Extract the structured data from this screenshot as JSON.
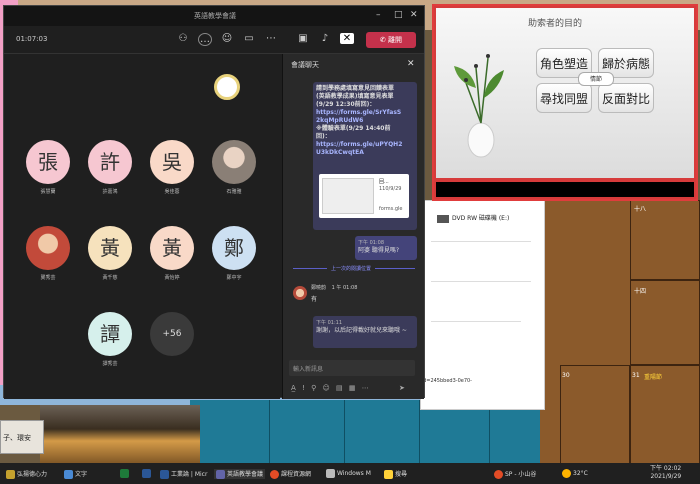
{
  "desktop": {
    "sticky_note": "子、環安",
    "calendar_right": {
      "cell_30": "30",
      "cell_31": "31",
      "cell_label_31": "重陽節",
      "row_labels": [
        "十八",
        "十四"
      ]
    },
    "dvd_label": "DVD RW 磁碟機 (E:)",
    "url_fragment": "ed=245bbed3-0e70-"
  },
  "teams": {
    "window_title": "英語教學會議",
    "elapsed_time": "01:07:03",
    "leave_label": "離開",
    "participants": [
      {
        "initial": "張",
        "name": "張慧蘭",
        "color": "#f6c7d1"
      },
      {
        "initial": "許",
        "name": "許嘉鴻",
        "color": "#f6c7d1"
      },
      {
        "initial": "吳",
        "name": "吳佳蓉",
        "color": "#f9d9c8"
      },
      {
        "initial": "",
        "name": "石雅雅",
        "color": "#9a8f86"
      },
      {
        "initial": "",
        "name": "龔秀芸",
        "color": "#c24a3a"
      },
      {
        "initial": "黃",
        "name": "黃千慈",
        "color": "#f6e2bd"
      },
      {
        "initial": "黃",
        "name": "黃怡婷",
        "color": "#f9d9c8"
      },
      {
        "initial": "鄭",
        "name": "鄭中宇",
        "color": "#cde0f2"
      },
      {
        "initial": "譚",
        "name": "譚秀芸",
        "color": "#d6f0ec"
      },
      {
        "initial": "+56",
        "name": "",
        "color": "#3a3a3a"
      }
    ],
    "chat": {
      "title": "會議聊天",
      "message1_lines": [
        "請到學務處填寫意見回饋表單",
        "(英語教學成果)填寫意見表單",
        "(9/29 12:30前回)：",
        "https://forms.gle/SrYfasS",
        "2kqMpRUdW6",
        "※體驗表單(9/29 14:40前",
        "回)：",
        "https://forms.gle/uPYQH2",
        "U3kDkCwqtEA"
      ],
      "card_title": "回...",
      "card_sub": "110/9/29",
      "card_site": "forms.gle",
      "outgoing_time": "下午 01:08",
      "outgoing_text": "阿婆 聽得見嗎?",
      "unread_divider": "上一次的閱讀位置",
      "reply_author": "鄭曉韵",
      "reply_time": "1 午 01:08",
      "reply_text": "有",
      "last_time": "下午 01:11",
      "last_text": "謝謝，以后記得載好就兒來聽哦 ~",
      "input_placeholder": "輸入新訊息"
    }
  },
  "slide": {
    "title": "助索者的目的",
    "tiles": [
      "角色塑造",
      "歸於病態",
      "尋找同盟",
      "反面對比"
    ],
    "center_button": "情節"
  },
  "taskbar": {
    "items": [
      "弘揚德心力",
      "文字",
      "Excel",
      "Word",
      "工業論 | Micr",
      "英語教學會議",
      "課程資源網",
      "Windows M",
      "搜尋",
      "SP - 小山谷"
    ],
    "weather": "32°C",
    "clock_time": "下午 02:02",
    "clock_date": "2021/9/29"
  }
}
